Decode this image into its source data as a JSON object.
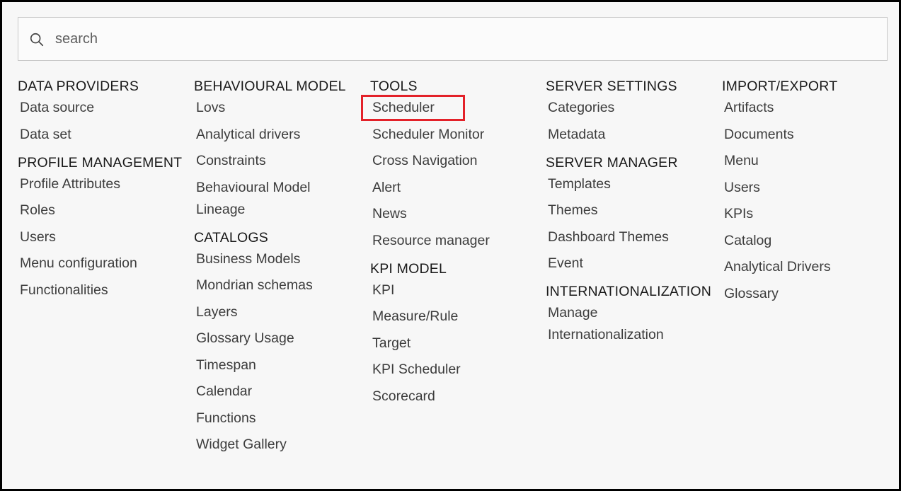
{
  "search": {
    "placeholder": "search",
    "value": ""
  },
  "highlight_color": "#e32129",
  "columns": [
    {
      "groups": [
        {
          "title": "DATA PROVIDERS",
          "items": [
            "Data source",
            "Data set"
          ]
        },
        {
          "title": "PROFILE MANAGEMENT",
          "items": [
            "Profile Attributes",
            "Roles",
            "Users",
            "Menu configuration",
            "Functionalities"
          ]
        }
      ]
    },
    {
      "groups": [
        {
          "title": "BEHAVIOURAL MODEL",
          "items": [
            "Lovs",
            "Analytical drivers",
            "Constraints",
            "Behavioural Model Lineage"
          ]
        },
        {
          "title": "CATALOGS",
          "items": [
            "Business Models",
            "Mondrian schemas",
            "Layers",
            "Glossary Usage",
            "Timespan",
            "Calendar",
            "Functions",
            "Widget Gallery"
          ]
        }
      ]
    },
    {
      "groups": [
        {
          "title": "TOOLS",
          "items": [
            "Scheduler",
            "Scheduler Monitor",
            "Cross Navigation",
            "Alert",
            "News",
            "Resource manager"
          ]
        },
        {
          "title": "KPI MODEL",
          "items": [
            "KPI",
            "Measure/Rule",
            "Target",
            "KPI Scheduler",
            "Scorecard"
          ]
        }
      ]
    },
    {
      "groups": [
        {
          "title": "SERVER SETTINGS",
          "items": [
            "Categories",
            "Metadata"
          ]
        },
        {
          "title": "SERVER MANAGER",
          "items": [
            "Templates",
            "Themes",
            "Dashboard Themes",
            "Event"
          ]
        },
        {
          "title": "INTERNATIONALIZATION",
          "items": [
            "Manage Internationalization"
          ]
        }
      ]
    },
    {
      "groups": [
        {
          "title": "IMPORT/EXPORT",
          "items": [
            "Artifacts",
            "Documents",
            "Menu",
            "Users",
            "KPIs",
            "Catalog",
            "Analytical Drivers",
            "Glossary"
          ]
        }
      ]
    }
  ]
}
